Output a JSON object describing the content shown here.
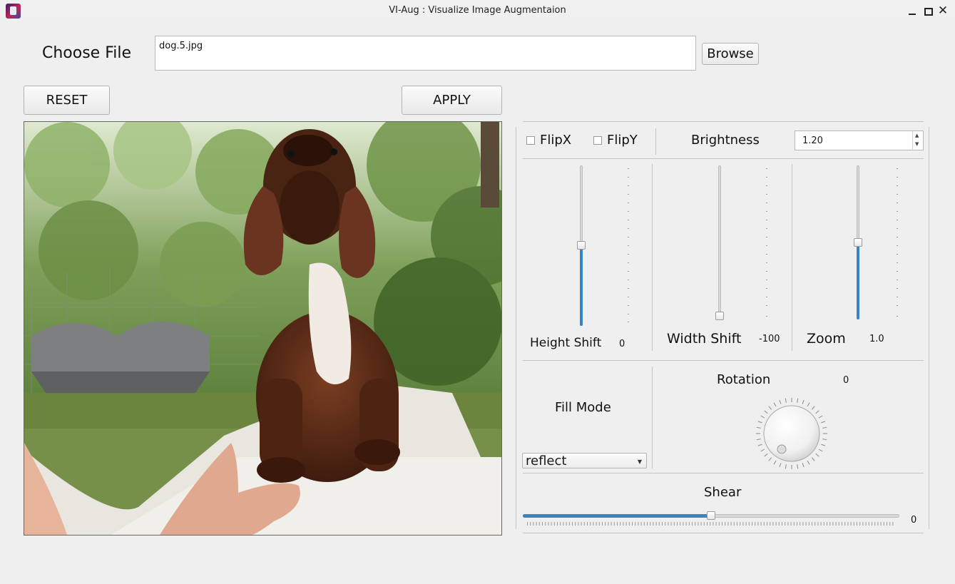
{
  "window": {
    "title": "VI-Aug : Visualize Image Augmentaion",
    "icon": "app-icon",
    "controls": [
      "minimize-icon",
      "maximize-icon",
      "close-icon"
    ],
    "close_glyph": "✕"
  },
  "file": {
    "label": "Choose File",
    "value": "dog.5.jpg",
    "browse_label": "Browse"
  },
  "actions": {
    "reset_label": "RESET",
    "apply_label": "APPLY"
  },
  "preview": {
    "content": "augmented dog photo"
  },
  "controls": {
    "flipx_label": "FlipX",
    "flipx_checked": false,
    "flipy_label": "FlipY",
    "flipy_checked": false,
    "brightness_label": "Brightness",
    "brightness_value": "1.20",
    "height_shift": {
      "label": "Height Shift",
      "value": "0",
      "level": 0.5
    },
    "width_shift": {
      "label": "Width Shift",
      "value": "-100",
      "level": 0.0
    },
    "zoom": {
      "label": "Zoom",
      "value": "1.0",
      "level": 0.5
    },
    "fill_mode_label": "Fill Mode",
    "fill_mode_value": "reflect",
    "rotation_label": "Rotation",
    "rotation_value": "0",
    "shear_label": "Shear",
    "shear_value": "0",
    "shear_level": 0.5
  },
  "colors": {
    "accent": "#3584c9",
    "background": "#efefef"
  }
}
